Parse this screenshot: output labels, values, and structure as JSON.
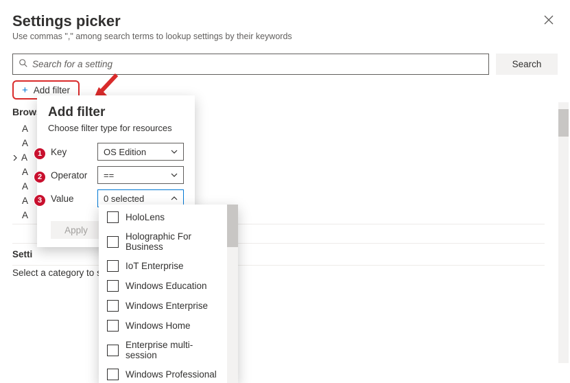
{
  "header": {
    "title": "Settings picker",
    "subtitle": "Use commas \",\" among search terms to lookup settings by their keywords"
  },
  "search": {
    "placeholder": "Search for a setting",
    "button": "Search"
  },
  "add_filter_button": "Add filter",
  "browse_label": "Brows",
  "categories": {
    "c1": "A",
    "c2": "A",
    "c3": "A",
    "c4": "A",
    "c5": "A",
    "c6": "A",
    "c7": "A"
  },
  "popover": {
    "title": "Add filter",
    "subtitle": "Choose filter type for resources",
    "key_label": "Key",
    "operator_label": "Operator",
    "value_label": "Value",
    "key_value": "OS Edition",
    "operator_value": "==",
    "value_value": "0 selected",
    "apply": "Apply",
    "badge1": "1",
    "badge2": "2",
    "badge3": "3"
  },
  "dropdown_options": [
    "HoloLens",
    "Holographic For Business",
    "IoT Enterprise",
    "Windows Education",
    "Windows Enterprise",
    "Windows Home",
    "Enterprise multi-session",
    "Windows Professional"
  ],
  "settings_name": "Setti",
  "select_category": "Select a category to s"
}
